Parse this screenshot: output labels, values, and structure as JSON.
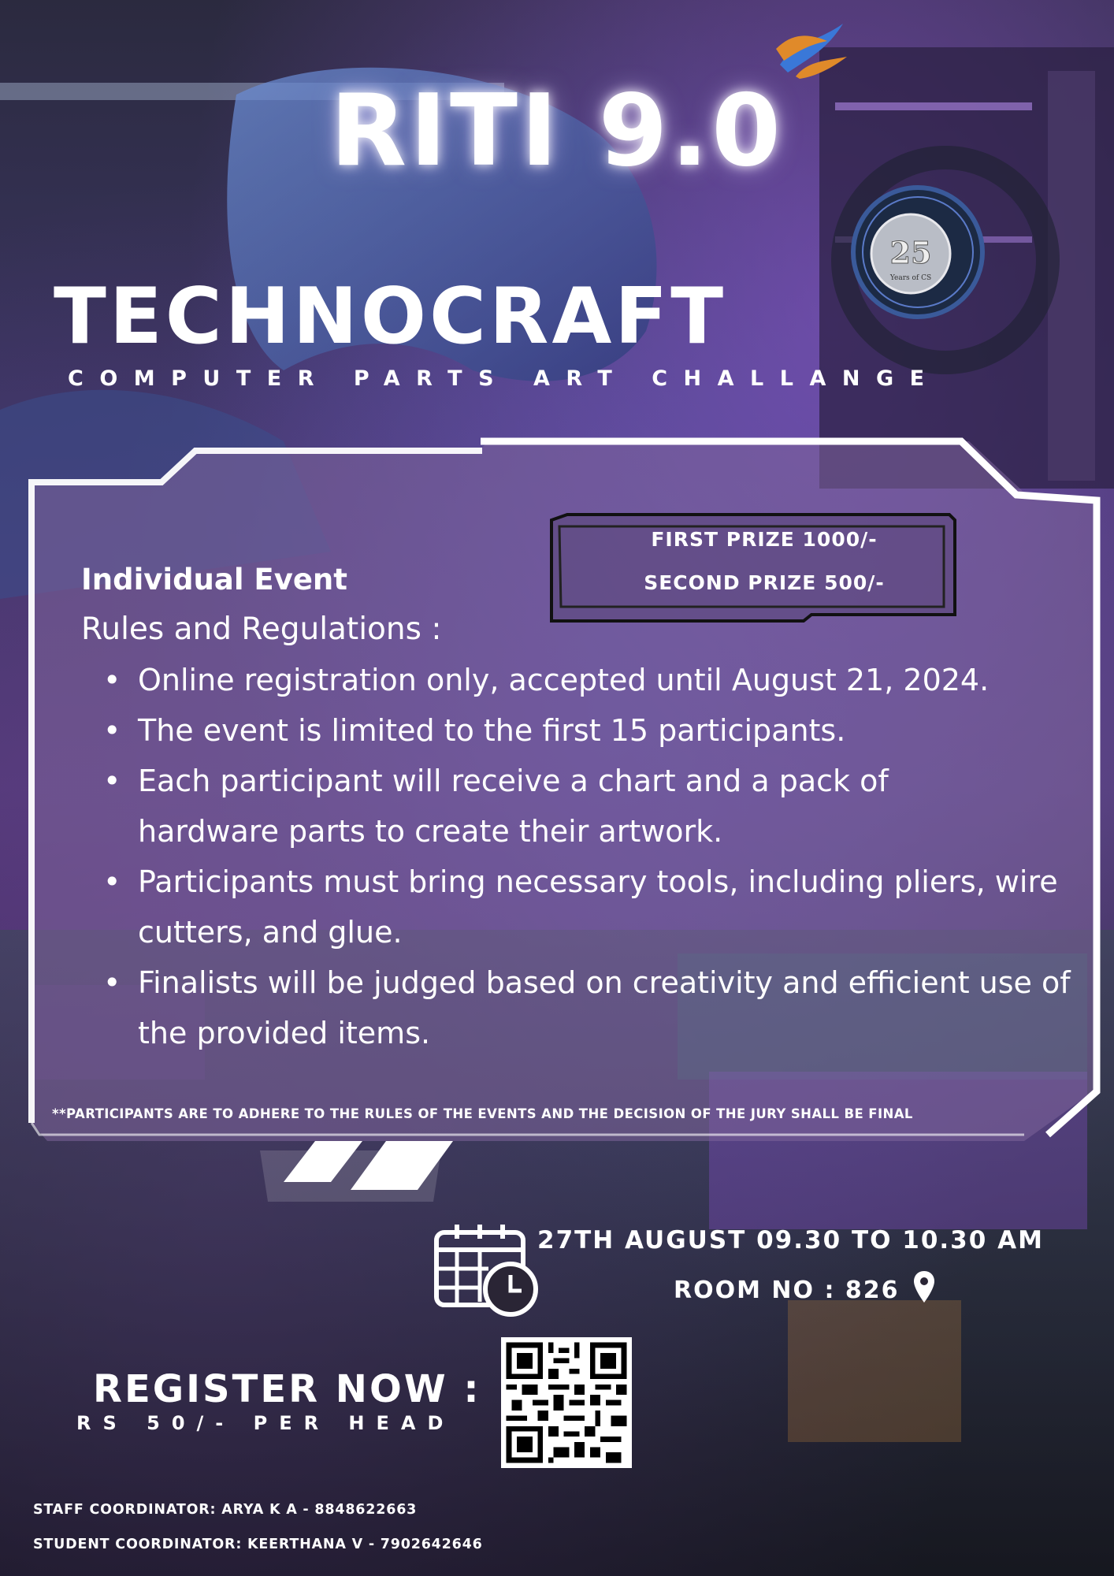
{
  "header": {
    "title": "RITI 9.0",
    "badge_text": "25 Years of CS"
  },
  "event": {
    "name": "TECHNOCRAFT",
    "tagline": "COMPUTER PARTS ART CHALLANGE"
  },
  "prizes": {
    "first": "FIRST PRIZE 1000/-",
    "second": "SECOND PRIZE 500/-"
  },
  "details": {
    "type": "Individual Event",
    "rules_heading": "Rules and Regulations :",
    "rules": [
      "Online registration only, accepted until August 21, 2024.",
      "The event is limited to the first 15 participants.",
      "Each participant will receive a chart and a pack of hardware parts to create their artwork.",
      "Participants must bring necessary tools, including pliers, wire cutters, and glue.",
      "Finalists will be judged based on creativity and efficient use of the provided items."
    ],
    "disclaimer": "**PARTICIPANTS ARE TO ADHERE TO THE RULES OF THE EVENTS  AND THE DECISION OF THE JURY SHALL BE FINAL"
  },
  "schedule": {
    "datetime": "27TH AUGUST 09.30 TO 10.30 AM",
    "room": "ROOM NO : 826"
  },
  "registration": {
    "cta": "REGISTER NOW :",
    "fee": "RS 50/- PER HEAD"
  },
  "coordinators": {
    "staff": "STAFF COORDINATOR: ARYA K A - 8848622663",
    "student": "STUDENT COORDINATOR: KEERTHANA V - 7902642646"
  },
  "colors": {
    "panel_fill": "rgba(120,95,150,0.55)",
    "frame": "#ffffff",
    "accent_purple": "#8a4fd0"
  },
  "icons": [
    "logo-bird-icon",
    "anniversary-badge-icon",
    "calendar-clock-icon",
    "location-pin-icon",
    "qr-code-icon"
  ]
}
